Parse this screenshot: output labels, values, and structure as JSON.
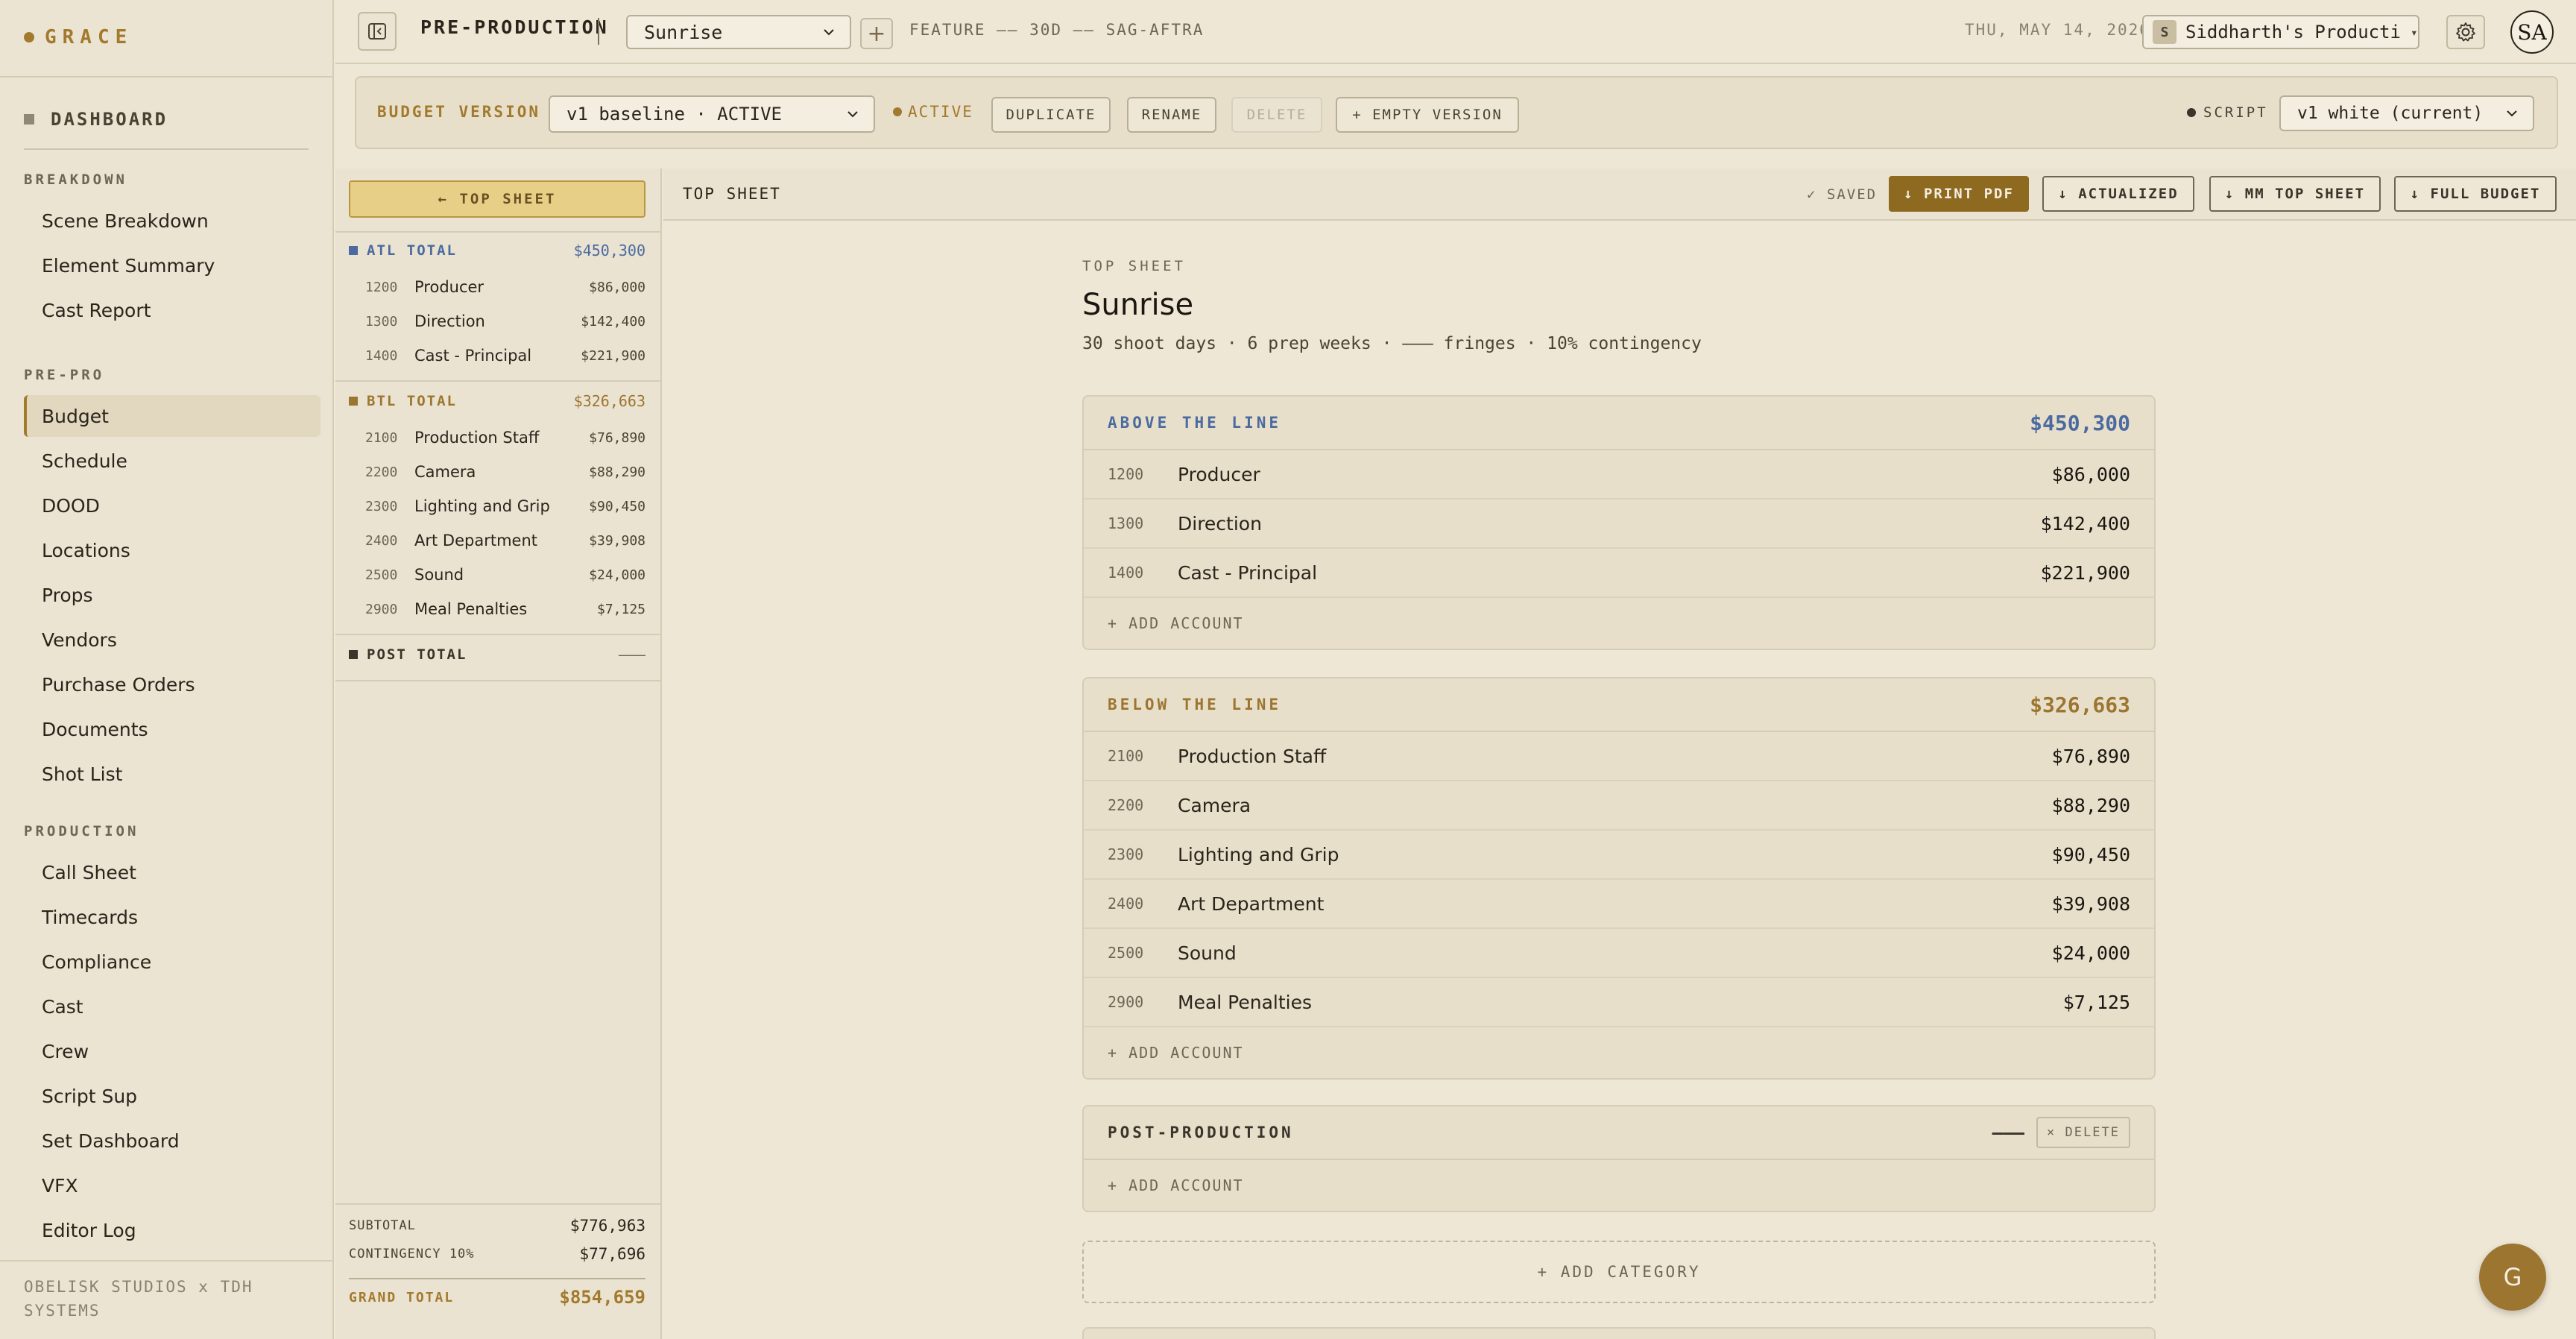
{
  "app": {
    "brand": "GRACE"
  },
  "sidebar": {
    "dashboard": "DASHBOARD",
    "sections": [
      {
        "title": "BREAKDOWN",
        "items": [
          "Scene Breakdown",
          "Element Summary",
          "Cast Report"
        ]
      },
      {
        "title": "PRE-PRO",
        "items": [
          "Budget",
          "Schedule",
          "DOOD",
          "Locations",
          "Props",
          "Vendors",
          "Purchase Orders",
          "Documents",
          "Shot List"
        ]
      },
      {
        "title": "PRODUCTION",
        "items": [
          "Call Sheet",
          "Timecards",
          "Compliance",
          "Cast",
          "Crew",
          "Script Sup",
          "Set Dashboard",
          "VFX",
          "Editor Log"
        ]
      }
    ],
    "active_item": "Budget",
    "footer": "OBELISK STUDIOS x TDH SYSTEMS"
  },
  "topbar": {
    "section": "PRE-PRODUCTION",
    "project": "Sunrise",
    "meta": "FEATURE —— 30D —— SAG-AFTRA",
    "date": "THU, MAY 14, 2026",
    "production_initial": "S",
    "production": "Siddharth's Production",
    "avatar": "SA"
  },
  "version_bar": {
    "label": "BUDGET VERSION",
    "version": "v1 baseline · ACTIVE",
    "status": "ACTIVE",
    "buttons": {
      "duplicate": "DUPLICATE",
      "rename": "RENAME",
      "delete": "DELETE",
      "empty": "+ EMPTY VERSION"
    },
    "script_label": "SCRIPT",
    "script_value": "v1 white (current)"
  },
  "left_panel": {
    "top_sheet_btn": "← TOP SHEET",
    "atl": {
      "label": "ATL TOTAL",
      "total": "$450,300",
      "rows": [
        {
          "code": "1200",
          "name": "Producer",
          "amount": "$86,000"
        },
        {
          "code": "1300",
          "name": "Direction",
          "amount": "$142,400"
        },
        {
          "code": "1400",
          "name": "Cast - Principal",
          "amount": "$221,900"
        }
      ]
    },
    "btl": {
      "label": "BTL TOTAL",
      "total": "$326,663",
      "rows": [
        {
          "code": "2100",
          "name": "Production Staff",
          "amount": "$76,890"
        },
        {
          "code": "2200",
          "name": "Camera",
          "amount": "$88,290"
        },
        {
          "code": "2300",
          "name": "Lighting and Grip",
          "amount": "$90,450"
        },
        {
          "code": "2400",
          "name": "Art Department",
          "amount": "$39,908"
        },
        {
          "code": "2500",
          "name": "Sound",
          "amount": "$24,000"
        },
        {
          "code": "2900",
          "name": "Meal Penalties",
          "amount": "$7,125"
        }
      ]
    },
    "post": {
      "label": "POST TOTAL",
      "total": "———"
    },
    "subtotal_label": "SUBTOTAL",
    "subtotal": "$776,963",
    "contingency_label": "CONTINGENCY 10%",
    "contingency": "$77,696",
    "grand_label": "GRAND TOTAL",
    "grand": "$854,659"
  },
  "main": {
    "header_title": "TOP SHEET",
    "saved": "✓ SAVED",
    "print": "↓ PRINT PDF",
    "actualized": "↓ ACTUALIZED",
    "mm_top_sheet": "↓ MM TOP SHEET",
    "full_budget": "↓ FULL BUDGET",
    "label": "TOP SHEET",
    "title": "Sunrise",
    "subtitle": "30 shoot days · 6 prep weeks · ——— fringes · 10% contingency",
    "atl": {
      "title": "ABOVE THE LINE",
      "total": "$450,300",
      "rows": [
        {
          "code": "1200",
          "name": "Producer",
          "amount": "$86,000"
        },
        {
          "code": "1300",
          "name": "Direction",
          "amount": "$142,400"
        },
        {
          "code": "1400",
          "name": "Cast - Principal",
          "amount": "$221,900"
        }
      ]
    },
    "btl": {
      "title": "BELOW THE LINE",
      "total": "$326,663",
      "rows": [
        {
          "code": "2100",
          "name": "Production Staff",
          "amount": "$76,890"
        },
        {
          "code": "2200",
          "name": "Camera",
          "amount": "$88,290"
        },
        {
          "code": "2300",
          "name": "Lighting and Grip",
          "amount": "$90,450"
        },
        {
          "code": "2400",
          "name": "Art Department",
          "amount": "$39,908"
        },
        {
          "code": "2500",
          "name": "Sound",
          "amount": "$24,000"
        },
        {
          "code": "2900",
          "name": "Meal Penalties",
          "amount": "$7,125"
        }
      ]
    },
    "post": {
      "title": "POST-PRODUCTION",
      "total": "———",
      "delete": "× DELETE"
    },
    "add_account": "+ ADD ACCOUNT",
    "add_category": "+ ADD CATEGORY"
  },
  "fab": "G",
  "colors": {
    "accent": "#a27a2e",
    "atl_blue": "#4a6aa0",
    "btl_gold": "#9c7630",
    "post_dark": "#3a342a"
  },
  "icons": {
    "sidebar_toggle": "sidebar-collapse-icon",
    "settings": "gear-icon",
    "chevron": "chevron-down-icon"
  }
}
